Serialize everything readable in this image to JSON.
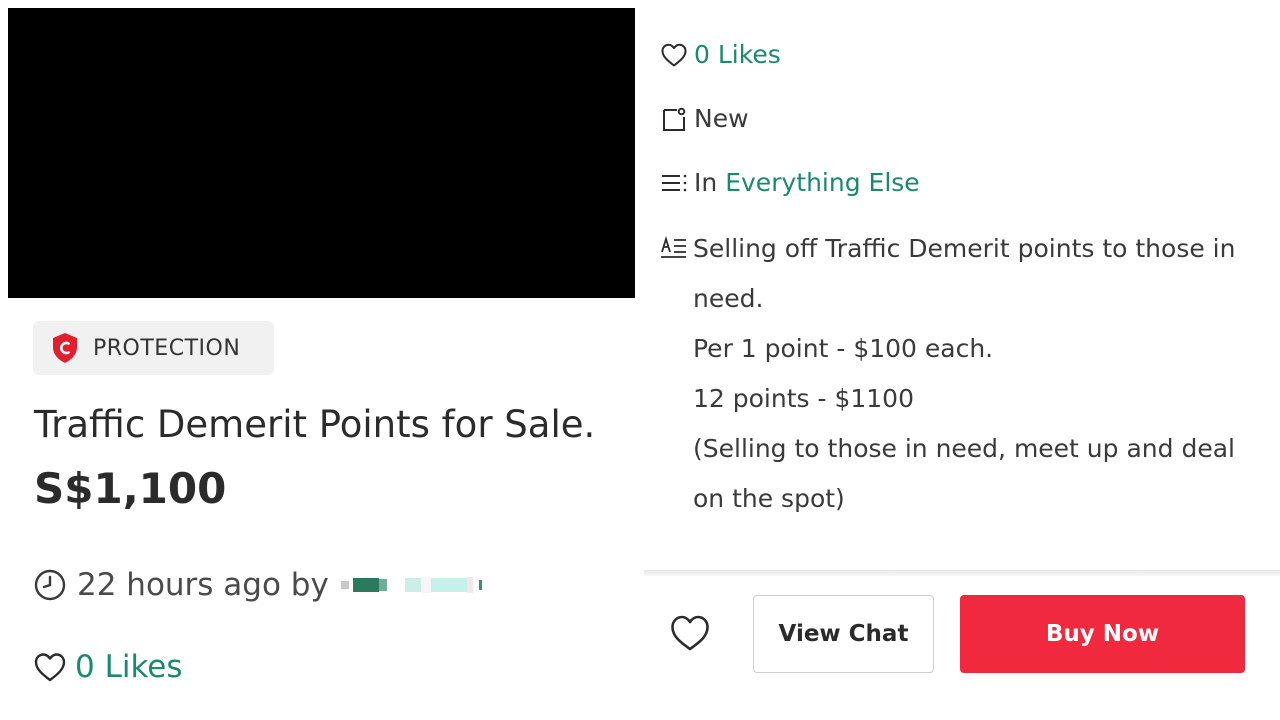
{
  "colors": {
    "accent_green": "#1a8a6e",
    "buy_red": "#f1293e",
    "protection_red": "#e0202e"
  },
  "listing": {
    "badge_label": "PROTECTION",
    "title": "Traffic Demerit Points for Sale.",
    "price": "S$1,100",
    "posted": "22 hours ago by",
    "likes": "0 Likes"
  },
  "details": {
    "likes": "0 Likes",
    "condition": "New",
    "category_prefix": "In",
    "category": "Everything Else",
    "description_lines": [
      "Selling off Traffic Demerit points to those in",
      "need.",
      "Per 1 point - $100 each.",
      "12 points - $1100",
      "(Selling to those in need, meet up and deal",
      "on the spot)"
    ]
  },
  "actions": {
    "view_chat": "View Chat",
    "buy_now": "Buy Now"
  },
  "icons": {
    "protection": "shield-c-icon",
    "time": "clock-icon",
    "like": "heart-icon",
    "condition": "tag-icon",
    "category": "list-icon",
    "description": "text-description-icon"
  }
}
